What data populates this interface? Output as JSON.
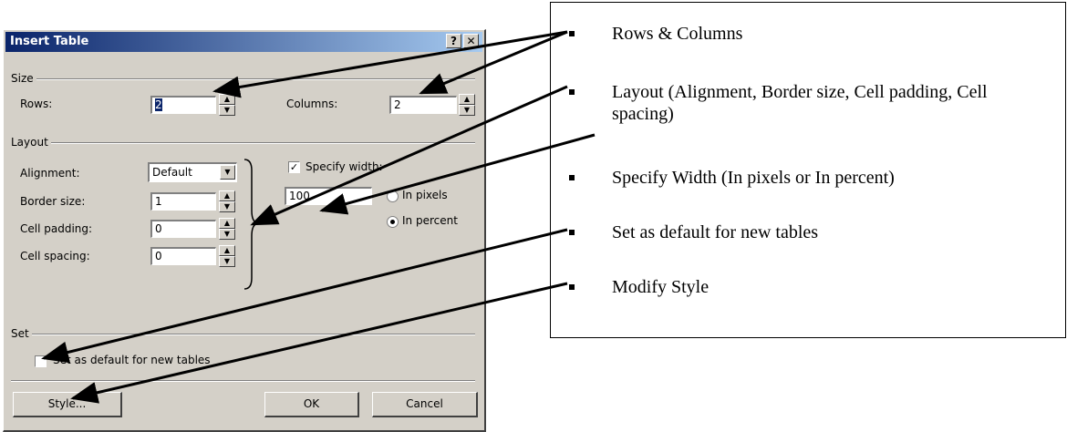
{
  "dialog": {
    "title": "Insert Table",
    "help_icon": "?",
    "close_icon": "✕",
    "size_group": "Size",
    "rows_label": "Rows:",
    "rows_value": "2",
    "columns_label": "Columns:",
    "columns_value": "2",
    "layout_group": "Layout",
    "alignment_label": "Alignment:",
    "alignment_value": "Default",
    "border_label": "Border size:",
    "border_value": "1",
    "padding_label": "Cell padding:",
    "padding_value": "0",
    "spacing_label": "Cell spacing:",
    "spacing_value": "0",
    "specify_width_label": "Specify width:",
    "specify_width_checked": true,
    "width_value": "100",
    "in_pixels_label": "In pixels",
    "in_percent_label": "In percent",
    "set_group": "Set",
    "default_label": "Set as default for new tables",
    "style_button": "Style...",
    "ok_button": "OK",
    "cancel_button": "Cancel"
  },
  "callouts": [
    {
      "text": "Rows & Columns"
    },
    {
      "text": "Layout (Alignment, Border size, Cell padding, Cell spacing)"
    },
    {
      "text": "Specify Width (In pixels or In percent)"
    },
    {
      "text": "Set as default for new tables"
    },
    {
      "text": "Modify Style"
    }
  ]
}
